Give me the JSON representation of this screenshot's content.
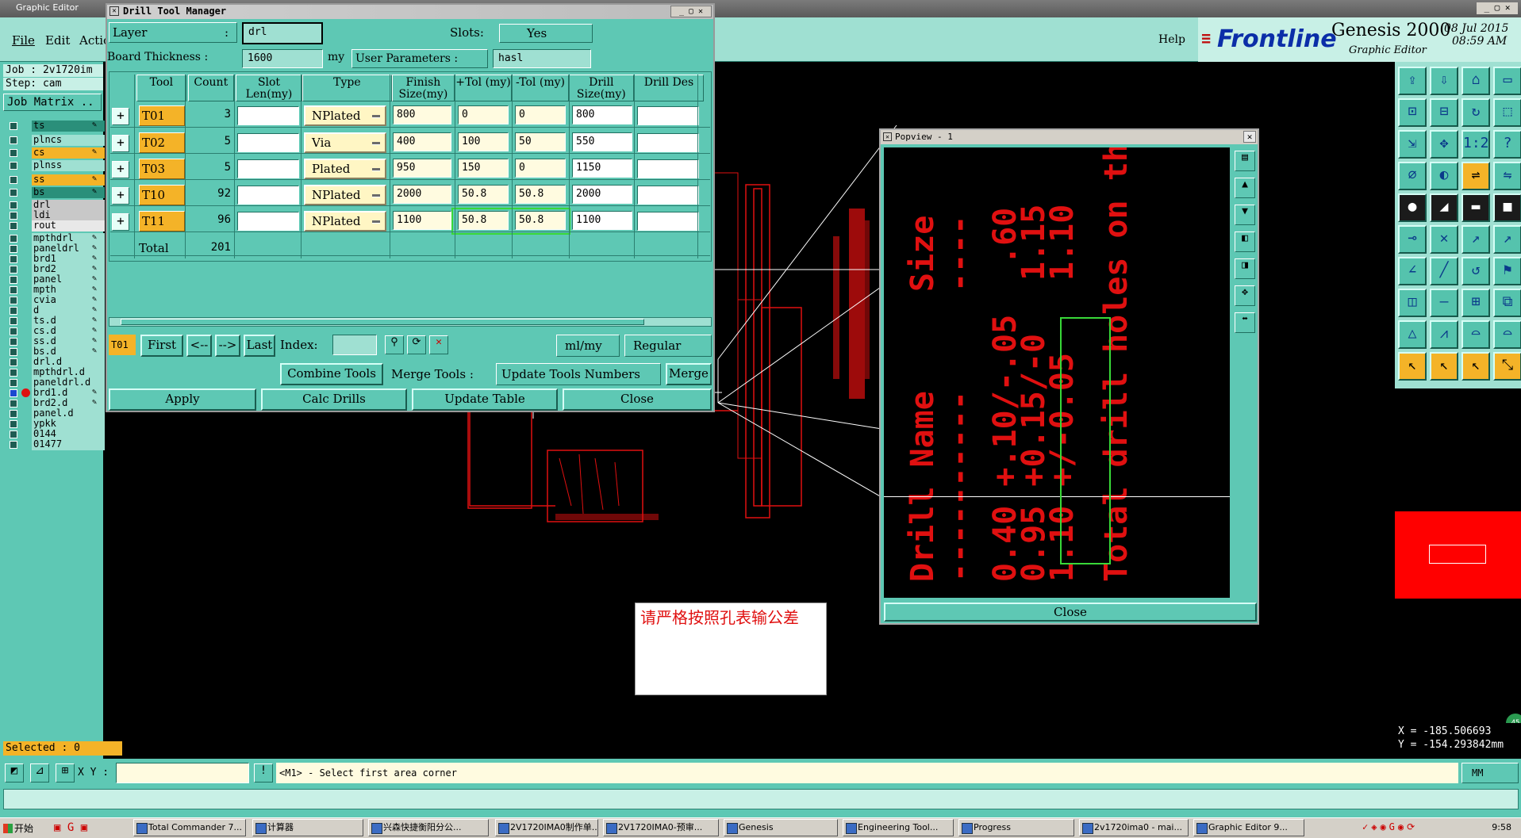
{
  "app": {
    "title": "Graphic Editor",
    "menu": [
      "File",
      "Edit",
      "Actic"
    ],
    "help": "Help",
    "brand": "Frontline",
    "product": "Genesis 2000",
    "product_sub": "Graphic Editor",
    "date": "08 Jul 2015",
    "time": "08:59 AM"
  },
  "job_panel": {
    "job": "Job : 2v1720im",
    "step": "Step: cam",
    "job_matrix": "Job Matrix ..",
    "selected": "Selected : 0"
  },
  "layers": [
    {
      "name": "ts",
      "color": "#2a8f7a",
      "state": "board"
    },
    {
      "name": "plncs",
      "color": "#9fe0d2"
    },
    {
      "name": "cs",
      "color": "#f4b328",
      "state": "active"
    },
    {
      "name": "plnss",
      "color": "#9fe0d2"
    },
    {
      "name": "ss",
      "color": "#f4b328",
      "state": "active"
    },
    {
      "name": "bs",
      "color": "#2a8f7a",
      "state": "board"
    },
    {
      "name": "drl",
      "color": "#c8c8c8"
    },
    {
      "name": "ldi",
      "color": "#c8c8c8"
    },
    {
      "name": "rout",
      "color": "#e8e8e8"
    },
    {
      "name": "mpthdrl",
      "color": "#9fe0d2"
    },
    {
      "name": "paneldrl",
      "color": "#9fe0d2"
    },
    {
      "name": "brd1",
      "color": "#9fe0d2"
    },
    {
      "name": "brd2",
      "color": "#9fe0d2"
    },
    {
      "name": "panel",
      "color": "#9fe0d2"
    },
    {
      "name": "mpth",
      "color": "#9fe0d2"
    },
    {
      "name": "cvia",
      "color": "#9fe0d2"
    },
    {
      "name": "d",
      "color": "#9fe0d2"
    },
    {
      "name": "ts.d",
      "color": "#9fe0d2"
    },
    {
      "name": "cs.d",
      "color": "#9fe0d2"
    },
    {
      "name": "ss.d",
      "color": "#9fe0d2"
    },
    {
      "name": "bs.d",
      "color": "#9fe0d2"
    },
    {
      "name": "drl.d",
      "color": "#9fe0d2"
    },
    {
      "name": "mpthdrl.d",
      "color": "#9fe0d2"
    },
    {
      "name": "paneldrl.d",
      "color": "#9fe0d2"
    },
    {
      "name": "brd1.d",
      "color": "#9fe0d2",
      "state": "displayed"
    },
    {
      "name": "brd2.d",
      "color": "#9fe0d2"
    },
    {
      "name": "panel.d",
      "color": "#9fe0d2"
    },
    {
      "name": "ypkk",
      "color": "#9fe0d2"
    },
    {
      "name": "0144",
      "color": "#9fe0d2"
    },
    {
      "name": "01477",
      "color": "#9fe0d2"
    }
  ],
  "drill_manager": {
    "title": "Drill Tool Manager",
    "layer_label": "Layer",
    "layer_value": "drl",
    "slots_label": "Slots:",
    "slots_value": "Yes",
    "thickness_label": "Board Thickness :",
    "thickness_value": "1600",
    "thickness_unit": "my",
    "user_params_label": "User Parameters :",
    "user_params_value": "hasl",
    "columns": [
      "Tool",
      "Count",
      "Slot Len(my)",
      "Type",
      "Finish Size(my)",
      "+Tol (my)",
      "-Tol (my)",
      "Drill Size(my)",
      "Drill Des"
    ],
    "rows": [
      {
        "tool": "T01",
        "count": "3",
        "slot": "",
        "type": "NPlated",
        "finish": "800",
        "ptol": "0",
        "ntol": "0",
        "drill": "800",
        "des": ""
      },
      {
        "tool": "T02",
        "count": "5",
        "slot": "",
        "type": "Via",
        "finish": "400",
        "ptol": "100",
        "ntol": "50",
        "drill": "550",
        "des": ""
      },
      {
        "tool": "T03",
        "count": "5",
        "slot": "",
        "type": "Plated",
        "finish": "950",
        "ptol": "150",
        "ntol": "0",
        "drill": "1150",
        "des": ""
      },
      {
        "tool": "T10",
        "count": "92",
        "slot": "",
        "type": "NPlated",
        "finish": "2000",
        "ptol": "50.8",
        "ntol": "50.8",
        "drill": "2000",
        "des": ""
      },
      {
        "tool": "T11",
        "count": "96",
        "slot": "",
        "type": "NPlated",
        "finish": "1100",
        "ptol": "50.8",
        "ntol": "50.8",
        "drill": "1100",
        "des": ""
      }
    ],
    "total_label": "Total",
    "total_count": "201",
    "nav": {
      "current": "T01",
      "first": "First",
      "prev": "<--",
      "next": "-->",
      "last": "Last",
      "index_label": "Index:",
      "units": "ml/my",
      "mode": "Regular"
    },
    "combine": "Combine Tools",
    "merge_tools": "Merge Tools :",
    "update_numbers": "Update Tools Numbers",
    "merge": "Merge",
    "apply": "Apply",
    "calc": "Calc Drills",
    "update_table": "Update Table",
    "close": "Close"
  },
  "popview": {
    "title": "Popview - 1",
    "close": "Close",
    "lines": [
      "Drill Name",
      "----------",
      "0.40 +.10/-.05",
      "0.95 +0.15/-0",
      "1.10 +/-0.05",
      "Total drill holes on th"
    ],
    "size_lines": [
      "Size",
      "----",
      ".60",
      "1.15",
      "1.10"
    ]
  },
  "note": "请严格按照孔表输公差",
  "status": {
    "xy_label": "X Y :",
    "prompt": "<M1> - Select first area corner",
    "units": "MM",
    "x": "X = -185.506693",
    "y": "Y = -154.293842mm"
  },
  "taskbar": {
    "start": "开始",
    "items": [
      "Total Commander 7...",
      "计算器",
      "兴森快捷衡阳分公...",
      "2V1720IMA0制作单...",
      "2V1720IMA0-预审...",
      "Genesis",
      "Engineering Tool...",
      "Progress",
      "2v1720ima0 - mai...",
      "Graphic Editor 9..."
    ],
    "clock": "9:58"
  },
  "colors": {
    "teal": "#5ec8b4",
    "light_teal": "#9fe0d2",
    "orange": "#f4b328",
    "drawing_red": "#e01010",
    "highlight_green": "#38d838"
  }
}
